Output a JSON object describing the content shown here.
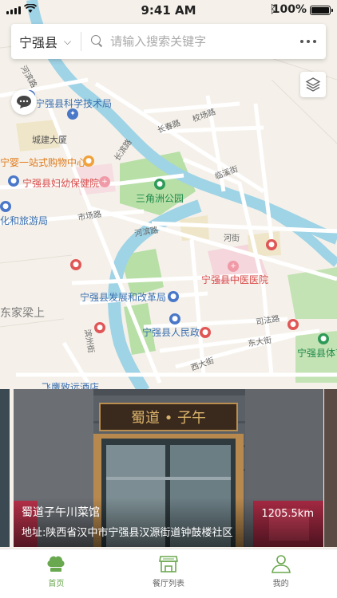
{
  "status_bar": {
    "time": "9:41 AM",
    "battery": "100%"
  },
  "search": {
    "city": "宁强县",
    "placeholder": "请输入搜索关键字"
  },
  "map": {
    "labels": {
      "hebinlu": "河滨路",
      "tech_bureau": "宁强县科学技术局",
      "xiaochanglu": "校场路",
      "changchunlu": "长春路",
      "chengjian": "城建大厦",
      "linxijie": "临溪街",
      "muying": "宁婴一站式购物中心",
      "changbinlu": "长滨路",
      "maternal": "宁强县妇幼保健院",
      "sanjiaozhou": "三角洲公园",
      "culture": "化和旅游局",
      "shichanglu": "市场路",
      "hebinlu2": "河滨路",
      "hejie": "河街",
      "tcm": "宁强县中医医院",
      "reform": "宁强县发展和改革局",
      "jiajialiang": "东家梁上",
      "government": "宁强县人民政",
      "sifalu": "司法路",
      "dongdajie": "东大街",
      "xidajie": "西大街",
      "sports": "宁强县体育",
      "hotel": "飞鹰致远酒店",
      "binjiang": "滨州街",
      "hebinlu_v": "河滨路"
    }
  },
  "restaurant": {
    "name": "蜀道子午川菜馆",
    "distance": "1205.5km",
    "address": "地址:陕西省汉中市宁强县汉源街道钟鼓楼社区",
    "sign": "蜀道 • 子午"
  },
  "tabs": [
    {
      "label": "首页",
      "icon": "chef-hat-icon",
      "active": true
    },
    {
      "label": "餐厅列表",
      "icon": "shop-icon",
      "active": false
    },
    {
      "label": "我的",
      "icon": "user-icon",
      "active": false
    }
  ],
  "colors": {
    "accent": "#6aa84f",
    "river": "#9fd3e6",
    "park": "#b7dfa6"
  }
}
